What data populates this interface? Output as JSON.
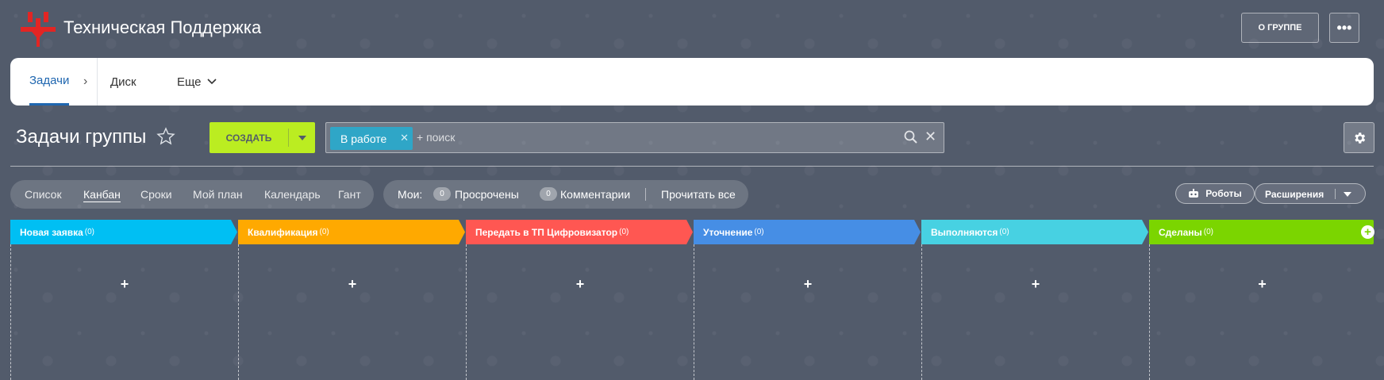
{
  "header": {
    "group_title": "Техническая Поддержка",
    "about_button": "О ГРУППЕ",
    "more_button": "•••"
  },
  "nav": {
    "tasks": "Задачи",
    "chevron": "›",
    "disk": "Диск",
    "more": "Еще"
  },
  "toolbar": {
    "page_title": "Задачи группы",
    "create_button": "СОЗДАТЬ",
    "filter_tag": "В работе",
    "search_placeholder": "+ поиск"
  },
  "views": {
    "items": [
      "Список",
      "Канбан",
      "Сроки",
      "Мой план",
      "Календарь",
      "Гант"
    ],
    "active": "Канбан"
  },
  "counters": {
    "my_label": "Мои:",
    "overdue_count": "0",
    "overdue_label": "Просрочены",
    "comments_count": "0",
    "comments_label": "Комментарии",
    "read_all": "Прочитать все"
  },
  "actions": {
    "robots": "Роботы",
    "extensions": "Расширения"
  },
  "kanban": {
    "columns": [
      {
        "title": "Новая заявка",
        "count": "(0)",
        "color": "#00bff3"
      },
      {
        "title": "Квалификация",
        "count": "(0)",
        "color": "#ffa900"
      },
      {
        "title": "Передать в ТП Цифровизатор",
        "count": "(0)",
        "color": "#ff5752"
      },
      {
        "title": "Уточнение",
        "count": "(0)",
        "color": "#468ee5"
      },
      {
        "title": "Выполняются",
        "count": "(0)",
        "color": "#47d1e2"
      },
      {
        "title": "Сделаны",
        "count": "(0)",
        "color": "#7bd500"
      }
    ],
    "add_symbol": "+"
  },
  "colors": {
    "background": "#525b6b",
    "accent_blue": "#2067b0",
    "create_green": "#bbed21",
    "filter_tag": "#2fa6c7"
  }
}
